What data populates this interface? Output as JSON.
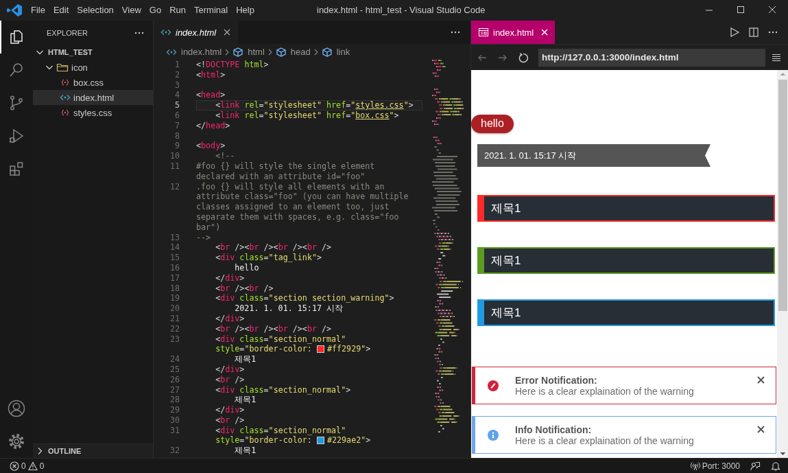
{
  "title_bar": {
    "menu": [
      "File",
      "Edit",
      "Selection",
      "View",
      "Go",
      "Run",
      "Terminal",
      "Help"
    ],
    "title": "index.html - html_test - Visual Studio Code"
  },
  "activity_bar": {
    "items": [
      {
        "kind": "files",
        "selected": true
      },
      {
        "kind": "search",
        "selected": false
      },
      {
        "kind": "source_control",
        "selected": false
      },
      {
        "kind": "run",
        "selected": false
      },
      {
        "kind": "extensions",
        "selected": false
      }
    ],
    "bottom": [
      {
        "kind": "account"
      },
      {
        "kind": "settings"
      }
    ]
  },
  "sidebar": {
    "title": "EXPLORER",
    "root": {
      "label": "HTML_TEST",
      "expanded": true,
      "children": [
        {
          "label": "icon",
          "kind": "folder",
          "expanded": true,
          "selected": false
        },
        {
          "label": "box.css",
          "kind": "css",
          "selected": false
        },
        {
          "label": "index.html",
          "kind": "html",
          "selected": true
        },
        {
          "label": "styles.css",
          "kind": "css",
          "selected": false
        }
      ]
    },
    "outline": {
      "label": "OUTLINE",
      "expanded": false
    }
  },
  "editor": {
    "tabs": [
      {
        "label": "index.html",
        "selected": true
      }
    ],
    "breadcrumb": [
      {
        "label": "index.html",
        "kind": "file"
      },
      {
        "label": "html",
        "kind": "symbol"
      },
      {
        "label": "head",
        "kind": "symbol"
      },
      {
        "label": "link",
        "kind": "symbol"
      }
    ],
    "rows": [
      {
        "num": "1",
        "current": false,
        "tokens": [
          {
            "kind": "punct",
            "text": "<!"
          },
          {
            "kind": "tag",
            "text": "DOCTYPE"
          },
          {
            "kind": "attr",
            "text": " html"
          },
          {
            "kind": "punct",
            "text": ">"
          }
        ]
      },
      {
        "num": "2",
        "current": false,
        "tokens": [
          {
            "kind": "punct",
            "text": "<"
          },
          {
            "kind": "tag",
            "text": "html"
          },
          {
            "kind": "punct",
            "text": ">"
          }
        ]
      },
      {
        "num": "3",
        "current": false,
        "tokens": []
      },
      {
        "num": "4",
        "current": false,
        "tokens": [
          {
            "kind": "punct",
            "text": "<"
          },
          {
            "kind": "tag",
            "text": "head"
          },
          {
            "kind": "punct",
            "text": ">"
          }
        ]
      },
      {
        "num": "5",
        "current": true,
        "tokens": [
          {
            "kind": "punct",
            "text": "    <"
          },
          {
            "kind": "tag",
            "text": "link"
          },
          {
            "kind": "attr",
            "text": " rel"
          },
          {
            "kind": "punct",
            "text": "="
          },
          {
            "kind": "str",
            "text": "\"stylesheet\""
          },
          {
            "kind": "attr",
            "text": " href"
          },
          {
            "kind": "punct",
            "text": "="
          },
          {
            "kind": "str",
            "text": "\""
          },
          {
            "kind": "link",
            "text": "styles.css"
          },
          {
            "kind": "str",
            "text": "\""
          },
          {
            "kind": "punct",
            "text": ">"
          }
        ]
      },
      {
        "num": "6",
        "current": false,
        "tokens": [
          {
            "kind": "punct",
            "text": "    <"
          },
          {
            "kind": "tag",
            "text": "link"
          },
          {
            "kind": "attr",
            "text": " rel"
          },
          {
            "kind": "punct",
            "text": "="
          },
          {
            "kind": "str",
            "text": "\"stylesheet\""
          },
          {
            "kind": "attr",
            "text": " href"
          },
          {
            "kind": "punct",
            "text": "="
          },
          {
            "kind": "str",
            "text": "\""
          },
          {
            "kind": "link",
            "text": "box.css"
          },
          {
            "kind": "str",
            "text": "\""
          },
          {
            "kind": "punct",
            "text": ">"
          }
        ]
      },
      {
        "num": "7",
        "current": false,
        "tokens": [
          {
            "kind": "punct",
            "text": "</"
          },
          {
            "kind": "tag",
            "text": "head"
          },
          {
            "kind": "punct",
            "text": ">"
          }
        ]
      },
      {
        "num": "8",
        "current": false,
        "tokens": []
      },
      {
        "num": "9",
        "current": false,
        "tokens": [
          {
            "kind": "punct",
            "text": "<"
          },
          {
            "kind": "tag",
            "text": "body"
          },
          {
            "kind": "punct",
            "text": ">"
          }
        ]
      },
      {
        "num": "10",
        "current": false,
        "tokens": [
          {
            "kind": "comment",
            "text": "    <!--"
          }
        ]
      },
      {
        "num": "11",
        "current": false,
        "tokens": [
          {
            "kind": "comment",
            "text": "#foo {} will style the single element"
          }
        ]
      },
      {
        "current": false,
        "tokens": [
          {
            "kind": "comment",
            "text": "declared with an attribute id=\"foo\""
          }
        ]
      },
      {
        "num": "12",
        "current": false,
        "tokens": [
          {
            "kind": "comment",
            "text": ".foo {} will style all elements with an"
          }
        ]
      },
      {
        "current": false,
        "tokens": [
          {
            "kind": "comment",
            "text": "attribute class=\"foo\" (you can have multiple"
          }
        ]
      },
      {
        "current": false,
        "tokens": [
          {
            "kind": "comment",
            "text": "classes assigned to an element too, just"
          }
        ]
      },
      {
        "current": false,
        "tokens": [
          {
            "kind": "comment",
            "text": "separate them with spaces, e.g. class=\"foo"
          }
        ]
      },
      {
        "current": false,
        "tokens": [
          {
            "kind": "comment",
            "text": "bar\")"
          }
        ]
      },
      {
        "num": "13",
        "current": false,
        "tokens": [
          {
            "kind": "comment",
            "text": "-->"
          }
        ]
      },
      {
        "num": "14",
        "current": false,
        "tokens": [
          {
            "kind": "punct",
            "text": "    <"
          },
          {
            "kind": "tag",
            "text": "br"
          },
          {
            "kind": "punct",
            "text": " /><"
          },
          {
            "kind": "tag",
            "text": "br"
          },
          {
            "kind": "punct",
            "text": " /><"
          },
          {
            "kind": "tag",
            "text": "br"
          },
          {
            "kind": "punct",
            "text": " /><"
          },
          {
            "kind": "tag",
            "text": "br"
          },
          {
            "kind": "punct",
            "text": " />"
          }
        ]
      },
      {
        "num": "15",
        "current": false,
        "tokens": [
          {
            "kind": "punct",
            "text": "    <"
          },
          {
            "kind": "tag",
            "text": "div"
          },
          {
            "kind": "attr",
            "text": " class"
          },
          {
            "kind": "punct",
            "text": "="
          },
          {
            "kind": "str",
            "text": "\"tag_link\""
          },
          {
            "kind": "punct",
            "text": ">"
          }
        ]
      },
      {
        "num": "16",
        "current": false,
        "tokens": [
          {
            "kind": "plain",
            "text": "        hello"
          }
        ]
      },
      {
        "num": "17",
        "current": false,
        "tokens": [
          {
            "kind": "punct",
            "text": "    </"
          },
          {
            "kind": "tag",
            "text": "div"
          },
          {
            "kind": "punct",
            "text": ">"
          }
        ]
      },
      {
        "num": "18",
        "current": false,
        "tokens": [
          {
            "kind": "punct",
            "text": "    <"
          },
          {
            "kind": "tag",
            "text": "br"
          },
          {
            "kind": "punct",
            "text": " /><"
          },
          {
            "kind": "tag",
            "text": "br"
          },
          {
            "kind": "punct",
            "text": " />"
          }
        ]
      },
      {
        "num": "19",
        "current": false,
        "tokens": [
          {
            "kind": "punct",
            "text": "    <"
          },
          {
            "kind": "tag",
            "text": "div"
          },
          {
            "kind": "attr",
            "text": " class"
          },
          {
            "kind": "punct",
            "text": "="
          },
          {
            "kind": "str",
            "text": "\"section section_warning\""
          },
          {
            "kind": "punct",
            "text": ">"
          }
        ]
      },
      {
        "num": "20",
        "current": false,
        "tokens": [
          {
            "kind": "plain",
            "text": "        2021. 1. 01. 15:17 시작"
          }
        ]
      },
      {
        "num": "21",
        "current": false,
        "tokens": [
          {
            "kind": "punct",
            "text": "    </"
          },
          {
            "kind": "tag",
            "text": "div"
          },
          {
            "kind": "punct",
            "text": ">"
          }
        ]
      },
      {
        "num": "22",
        "current": false,
        "tokens": [
          {
            "kind": "punct",
            "text": "    <"
          },
          {
            "kind": "tag",
            "text": "br"
          },
          {
            "kind": "punct",
            "text": " /><"
          },
          {
            "kind": "tag",
            "text": "br"
          },
          {
            "kind": "punct",
            "text": " /><"
          },
          {
            "kind": "tag",
            "text": "br"
          },
          {
            "kind": "punct",
            "text": " /><"
          },
          {
            "kind": "tag",
            "text": "br"
          },
          {
            "kind": "punct",
            "text": " />"
          }
        ]
      },
      {
        "num": "23",
        "current": false,
        "tokens": [
          {
            "kind": "punct",
            "text": "    <"
          },
          {
            "kind": "tag",
            "text": "div"
          },
          {
            "kind": "attr",
            "text": " class"
          },
          {
            "kind": "punct",
            "text": "="
          },
          {
            "kind": "str",
            "text": "\"section_normal\""
          }
        ]
      },
      {
        "current": false,
        "tokens": [
          {
            "kind": "attr",
            "text": "    style"
          },
          {
            "kind": "punct",
            "text": "="
          },
          {
            "kind": "str",
            "text": "\"border-color: "
          },
          {
            "kind": "swatch",
            "color": "#ff2929"
          },
          {
            "kind": "str",
            "text": "#ff2929\""
          },
          {
            "kind": "punct",
            "text": ">"
          }
        ]
      },
      {
        "num": "24",
        "current": false,
        "tokens": [
          {
            "kind": "plain",
            "text": "        제목1"
          }
        ]
      },
      {
        "num": "25",
        "current": false,
        "tokens": [
          {
            "kind": "punct",
            "text": "    </"
          },
          {
            "kind": "tag",
            "text": "div"
          },
          {
            "kind": "punct",
            "text": ">"
          }
        ]
      },
      {
        "num": "26",
        "current": false,
        "tokens": [
          {
            "kind": "punct",
            "text": "    <"
          },
          {
            "kind": "tag",
            "text": "br"
          },
          {
            "kind": "punct",
            "text": " />"
          }
        ]
      },
      {
        "num": "27",
        "current": false,
        "tokens": [
          {
            "kind": "punct",
            "text": "    <"
          },
          {
            "kind": "tag",
            "text": "div"
          },
          {
            "kind": "attr",
            "text": " class"
          },
          {
            "kind": "punct",
            "text": "="
          },
          {
            "kind": "str",
            "text": "\"section_normal\""
          },
          {
            "kind": "punct",
            "text": ">"
          }
        ]
      },
      {
        "num": "28",
        "current": false,
        "tokens": [
          {
            "kind": "plain",
            "text": "        제목1"
          }
        ]
      },
      {
        "num": "29",
        "current": false,
        "tokens": [
          {
            "kind": "punct",
            "text": "    </"
          },
          {
            "kind": "tag",
            "text": "div"
          },
          {
            "kind": "punct",
            "text": ">"
          }
        ]
      },
      {
        "num": "30",
        "current": false,
        "tokens": [
          {
            "kind": "punct",
            "text": "    <"
          },
          {
            "kind": "tag",
            "text": "br"
          },
          {
            "kind": "punct",
            "text": " />"
          }
        ]
      },
      {
        "num": "31",
        "current": false,
        "tokens": [
          {
            "kind": "punct",
            "text": "    <"
          },
          {
            "kind": "tag",
            "text": "div"
          },
          {
            "kind": "attr",
            "text": " class"
          },
          {
            "kind": "punct",
            "text": "="
          },
          {
            "kind": "str",
            "text": "\"section_normal\""
          }
        ]
      },
      {
        "current": false,
        "tokens": [
          {
            "kind": "attr",
            "text": "    style"
          },
          {
            "kind": "punct",
            "text": "="
          },
          {
            "kind": "str",
            "text": "\"border-color: "
          },
          {
            "kind": "swatch",
            "color": "#229ae2"
          },
          {
            "kind": "str",
            "text": "#229ae2\""
          },
          {
            "kind": "punct",
            "text": ">"
          }
        ]
      },
      {
        "num": "32",
        "current": false,
        "tokens": [
          {
            "kind": "plain",
            "text": "        제목1"
          }
        ]
      }
    ]
  },
  "preview": {
    "tab": {
      "label": "index.html",
      "selected": true
    },
    "url": "http://127.0.0.1:3000/index.html",
    "tag_link": "hello",
    "warning": "2021. 1. 01. 15:17 시작",
    "sections": [
      {
        "title": "제목1",
        "color": "#ff2929"
      },
      {
        "title": "제목1",
        "color": "#5c9b22"
      },
      {
        "title": "제목1",
        "color": "#229ae2"
      }
    ],
    "notifications": [
      {
        "kind": "error",
        "title": "Error Notification:",
        "message": "Here is a clear explaination of the warning"
      },
      {
        "kind": "info",
        "title": "Info Notification:",
        "message": "Here is a clear explaination of the warning"
      }
    ]
  },
  "status_bar": {
    "errors": "0",
    "warnings": "0",
    "port": "Port: 3000"
  }
}
